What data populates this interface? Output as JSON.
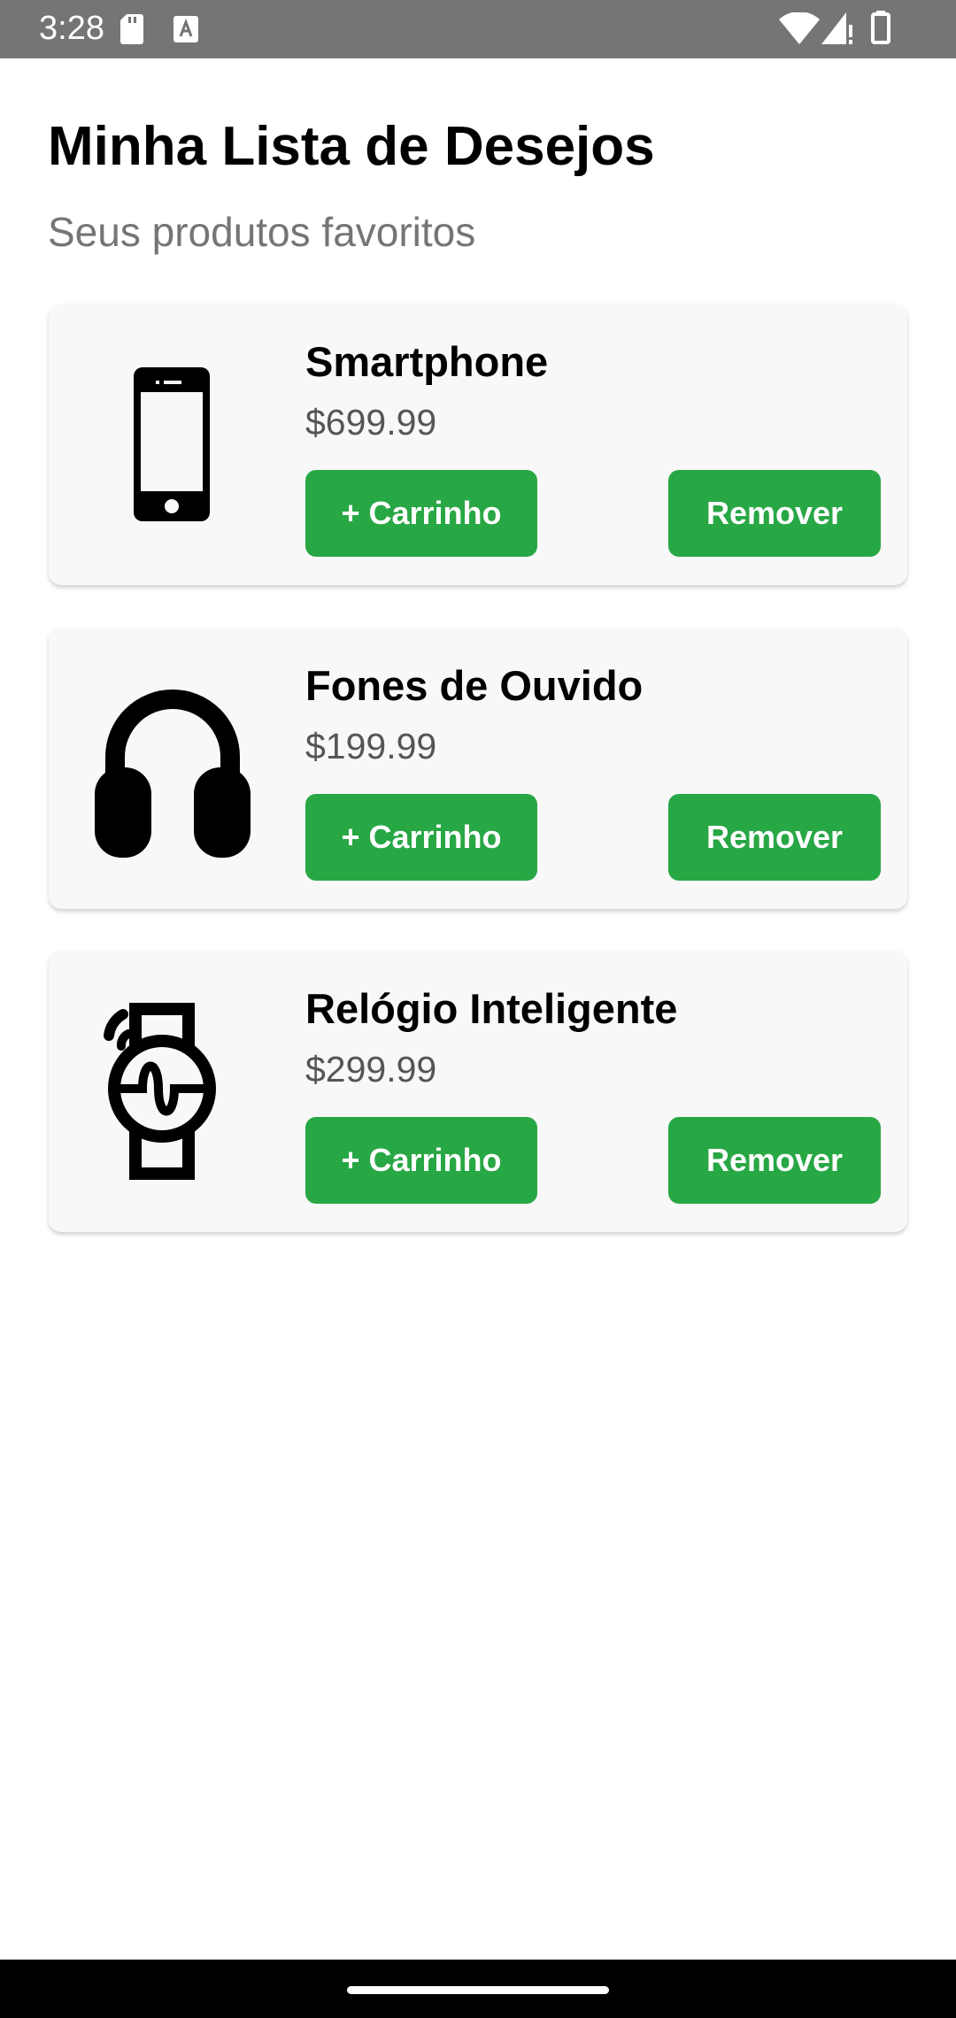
{
  "status_bar": {
    "time": "3:28",
    "icons": [
      "sd-card-icon",
      "keyboard-a-icon",
      "wifi-icon",
      "signal-icon",
      "battery-icon"
    ]
  },
  "header": {
    "title": "Minha Lista de Desejos",
    "subtitle": "Seus produtos favoritos"
  },
  "products": [
    {
      "name": "Smartphone",
      "price": "$699.99",
      "icon": "smartphone-icon",
      "cart_label": "+ Carrinho",
      "remove_label": "Remover"
    },
    {
      "name": "Fones de Ouvido",
      "price": "$199.99",
      "icon": "headphones-icon",
      "cart_label": "+ Carrinho",
      "remove_label": "Remover"
    },
    {
      "name": "Relógio Inteligente",
      "price": "$299.99",
      "icon": "smartwatch-icon",
      "cart_label": "+ Carrinho",
      "remove_label": "Remover"
    }
  ],
  "colors": {
    "accent_green": "#28a745",
    "status_bar": "#757575",
    "card_background": "#f8f8f8",
    "subtitle_gray": "#757575"
  }
}
